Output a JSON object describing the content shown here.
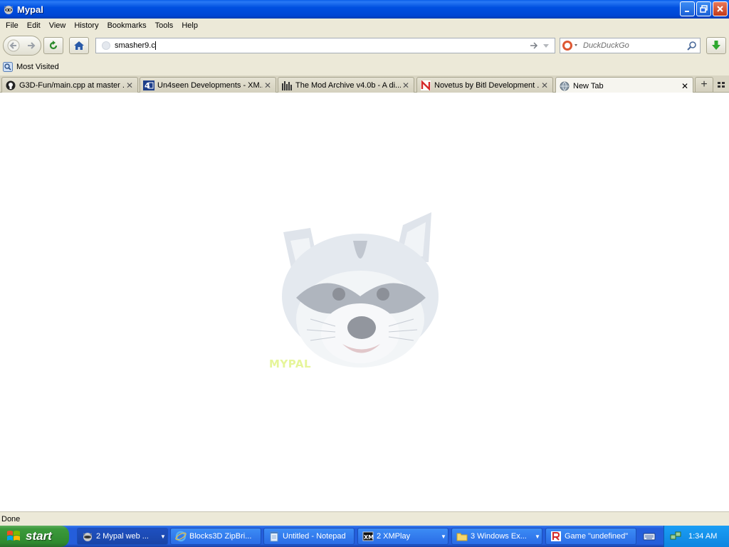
{
  "window": {
    "title": "Mypal"
  },
  "menu": {
    "items": [
      "File",
      "Edit",
      "View",
      "History",
      "Bookmarks",
      "Tools",
      "Help"
    ]
  },
  "navbar": {
    "url": "smasher9.c",
    "search_placeholder": "DuckDuckGo",
    "icons": [
      "back-icon",
      "forward-icon",
      "reload-icon",
      "home-icon",
      "download-icon"
    ]
  },
  "bookmarks": {
    "items": [
      {
        "label": "Most Visited"
      }
    ]
  },
  "tabs": {
    "items": [
      {
        "label": "G3D-Fun/main.cpp at master ...",
        "icon": "github-icon"
      },
      {
        "label": "Un4seen Developments - XM...",
        "icon": "un4seen-icon"
      },
      {
        "label": "The Mod Archive v4.0b - A di...",
        "icon": "modarchive-icon"
      },
      {
        "label": "Novetus by Bitl Development ...",
        "icon": "novetus-icon"
      },
      {
        "label": "New Tab",
        "icon": "globe-icon",
        "active": true
      }
    ]
  },
  "content": {
    "logo_text": "MYPAL"
  },
  "status": {
    "text": "Done"
  },
  "taskbar": {
    "start_label": "start",
    "tasks": [
      {
        "label": "2 Mypal web ...",
        "has_arrow": true,
        "active": true
      },
      {
        "label": "Blocks3D ZipBri...",
        "has_arrow": false
      },
      {
        "label": "Untitled - Notepad",
        "has_arrow": false
      },
      {
        "label": "2 XMPlay",
        "has_arrow": true
      },
      {
        "label": "3 Windows Ex...",
        "has_arrow": true
      },
      {
        "label": "Game \"undefined\"",
        "has_arrow": false
      }
    ],
    "clock": "1:34 AM"
  }
}
